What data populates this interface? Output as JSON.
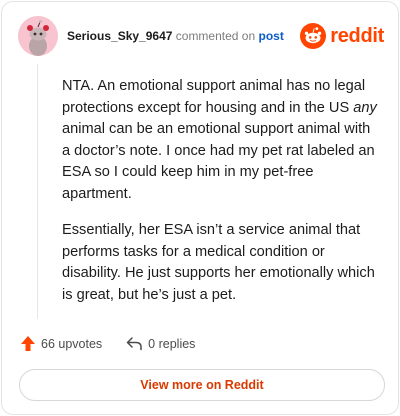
{
  "comment": {
    "author": "Serious_Sky_9647",
    "action_text": "commented on",
    "post_link": "post",
    "paragraph_1_a": "NTA. An emotional support animal has no legal protections except for housing and in the US ",
    "paragraph_1_em": "any",
    "paragraph_1_b": " animal can be an emotional support animal with a doctor’s note. I once had my pet rat labeled an ESA so I could keep him in my pet-free apartment.",
    "paragraph_2": "Essentially, her ESA isn’t a service animal that performs tasks for a medical condition or disability. He just supports her emotionally which is great, but he’s just a pet."
  },
  "brand": {
    "name": "reddit",
    "color": "#ff4500"
  },
  "actions": {
    "upvotes_label": "66 upvotes",
    "replies_label": "0 replies",
    "upvote_color": "#ff4500"
  },
  "footer": {
    "view_more_label": "View more on Reddit"
  },
  "icons": [
    "avatar-snoo-icon",
    "reddit-logo-icon",
    "upvote-arrow-icon",
    "reply-arrow-icon"
  ]
}
